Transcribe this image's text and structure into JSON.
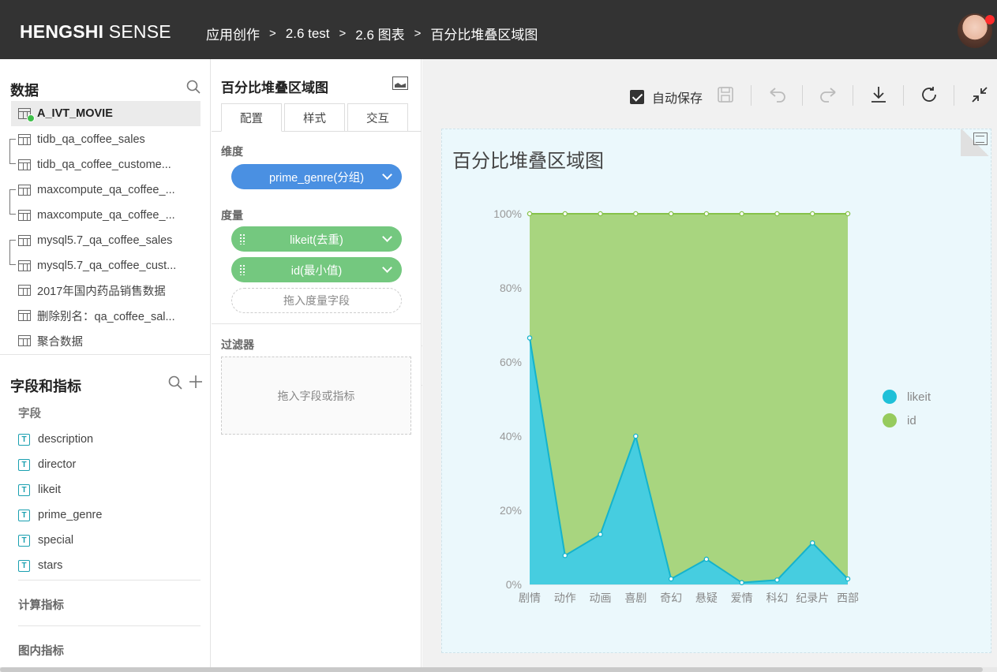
{
  "topbar": {
    "brand_bold": "HENGSHI",
    "brand_light": "SENSE",
    "breadcrumb": [
      "应用创作",
      "2.6 test",
      "2.6 图表",
      "百分比堆叠区域图"
    ],
    "separator": ">"
  },
  "data_panel": {
    "title": "数据",
    "datasets": [
      {
        "label": "A_IVT_MOVIE",
        "active": true
      },
      {
        "label": "tidb_qa_coffee_sales"
      },
      {
        "label": "tidb_qa_coffee_custome..."
      },
      {
        "label": "maxcompute_qa_coffee_..."
      },
      {
        "label": "maxcompute_qa_coffee_..."
      },
      {
        "label": "mysql5.7_qa_coffee_sales"
      },
      {
        "label": "mysql5.7_qa_coffee_cust..."
      },
      {
        "label": "2017年国内药品销售数据"
      },
      {
        "label": "删除别名：qa_coffee_sal..."
      },
      {
        "label": "聚合数据"
      }
    ]
  },
  "fields_panel": {
    "title": "字段和指标",
    "fields_label": "字段",
    "field_type_glyph": "T",
    "fields": [
      "description",
      "director",
      "likeit",
      "prime_genre",
      "special",
      "stars"
    ],
    "calc_metrics_label": "计算指标",
    "chart_metrics_label": "图内指标"
  },
  "config": {
    "title": "百分比堆叠区域图",
    "tabs": [
      "配置",
      "样式",
      "交互"
    ],
    "dimension_label": "维度",
    "dimension_pill": "prime_genre(分组)",
    "measure_label": "度量",
    "measure_pills": [
      "likeit(去重)",
      "id(最小值)"
    ],
    "measure_drop": "拖入度量字段",
    "filter_label": "过滤器",
    "filter_drop": "拖入字段或指标"
  },
  "toolbar": {
    "autosave_label": "自动保存",
    "autosave_checked": true
  },
  "chart_data": {
    "type": "area",
    "stacked": "percent",
    "title": "百分比堆叠区域图",
    "categories": [
      "剧情",
      "动作",
      "动画",
      "喜剧",
      "奇幻",
      "悬疑",
      "爱情",
      "科幻",
      "纪录片",
      "西部"
    ],
    "y_ticks": [
      "0%",
      "20%",
      "40%",
      "60%",
      "80%",
      "100%"
    ],
    "ylim": [
      0,
      100
    ],
    "series": [
      {
        "name": "likeit",
        "color": "#1fc0d8",
        "values": [
          66.5,
          7.8,
          13.5,
          40,
          1.5,
          6.8,
          0.5,
          1.2,
          11.2,
          1.5
        ]
      },
      {
        "name": "id",
        "color": "#96cb5d",
        "values": [
          33.5,
          92.2,
          86.5,
          60,
          98.5,
          93.2,
          99.5,
          98.8,
          88.8,
          98.5
        ]
      }
    ],
    "legend_position": "right",
    "grid": true
  }
}
